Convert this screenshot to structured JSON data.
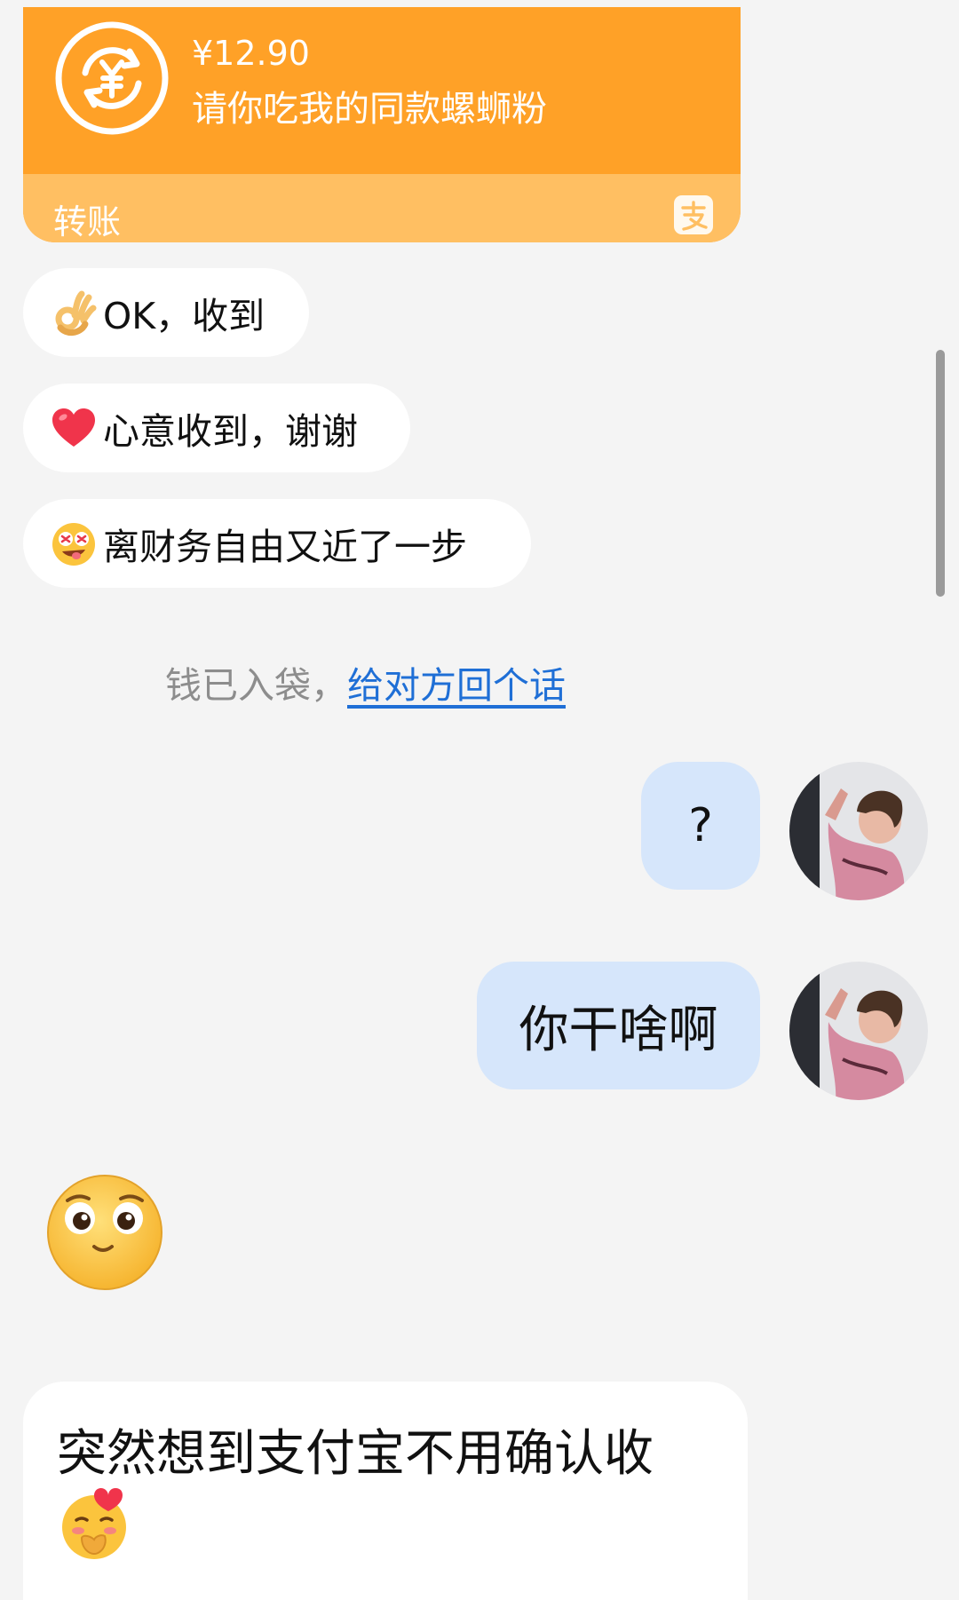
{
  "transfer": {
    "amount": "¥12.90",
    "note": "请你吃我的同款螺蛳粉",
    "label": "转账",
    "icon": "yuan-exchange-icon",
    "brand_icon": "alipay-icon",
    "colors": {
      "card": "#ffa127",
      "footer": "#ffbf62"
    }
  },
  "quick_replies": [
    {
      "emoji": "ok-hand-emoji",
      "text": "OK，收到"
    },
    {
      "emoji": "heart-emoji",
      "text": "心意收到，谢谢"
    },
    {
      "emoji": "money-eyes-emoji",
      "text": "离财务自由又近了一步"
    }
  ],
  "notice": {
    "text": "钱已入袋，",
    "link": "给对方回个话"
  },
  "messages_out": [
    {
      "text": "?"
    },
    {
      "text": "你干啥啊"
    }
  ],
  "incoming": {
    "sticker": "pleading-face-emoji",
    "text": "突然想到支付宝不用确认收",
    "trailing_emoji": "shy-face-emoji"
  },
  "colors": {
    "bubble_out": "#d6e6fb",
    "link": "#1f6fd6",
    "background": "#f4f4f4"
  }
}
